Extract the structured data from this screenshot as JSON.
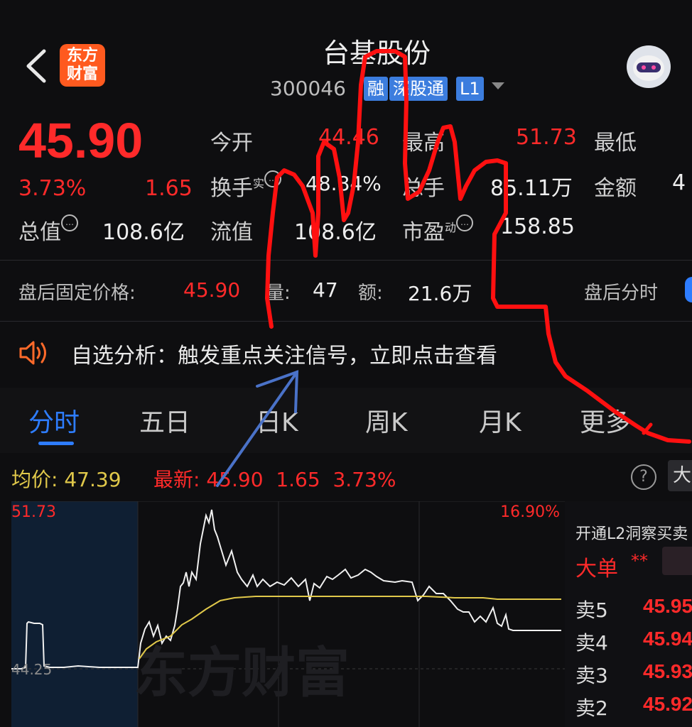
{
  "header": {
    "logo_text": "东方财富",
    "title": "台基股份",
    "code": "300046",
    "tags": [
      "融",
      "深股通",
      "L1"
    ]
  },
  "quote": {
    "price": "45.90",
    "change_pct": "3.73%",
    "change": "1.65",
    "open_label": "今开",
    "open": "44.46",
    "high_label": "最高",
    "high": "51.73",
    "low_label": "最低",
    "turnover_label": "换手",
    "turnover_sup": "实",
    "turnover": "48.84%",
    "volume_label": "总手",
    "volume": "85.11万",
    "amount_label": "金额",
    "amount": "4",
    "mktcap_label": "总值",
    "mktcap": "108.6亿",
    "float_label": "流值",
    "float": "108.6亿",
    "pe_label": "市盈",
    "pe_sup": "动",
    "pe": "158.85"
  },
  "after_hours": {
    "label": "盘后固定价格:",
    "price": "45.90",
    "vol_label": "量:",
    "vol": "47",
    "amt_label": "额:",
    "amt": "21.6万",
    "timeshare": "盘后分时"
  },
  "notice": {
    "text": "自选分析：触发重点关注信号，立即点击查看"
  },
  "tabs": [
    "分时",
    "五日",
    "日K",
    "周K",
    "月K",
    "更多"
  ],
  "stats": {
    "avg_label": "均价:",
    "avg": "47.39",
    "latest_label": "最新:",
    "latest": "45.90",
    "change": "1.65",
    "change_pct": "3.73%",
    "help": "?",
    "big_btn": "大"
  },
  "chart": {
    "max_label": "51.73",
    "max_pct": "16.90%",
    "base_label": "44.25",
    "watermark": "东方财富"
  },
  "panel": {
    "title": "开通L2洞察买卖",
    "big_order": "大单",
    "stars": "**",
    "asks": [
      {
        "label": "卖5",
        "price": "45.95"
      },
      {
        "label": "卖4",
        "price": "45.94"
      },
      {
        "label": "卖3",
        "price": "45.93"
      },
      {
        "label": "卖2",
        "price": "45.92"
      }
    ]
  },
  "colors": {
    "up": "#ff2a2a",
    "avg_line": "#e0c84a",
    "accent": "#2e7dff",
    "logo": "#ff5a1f"
  }
}
